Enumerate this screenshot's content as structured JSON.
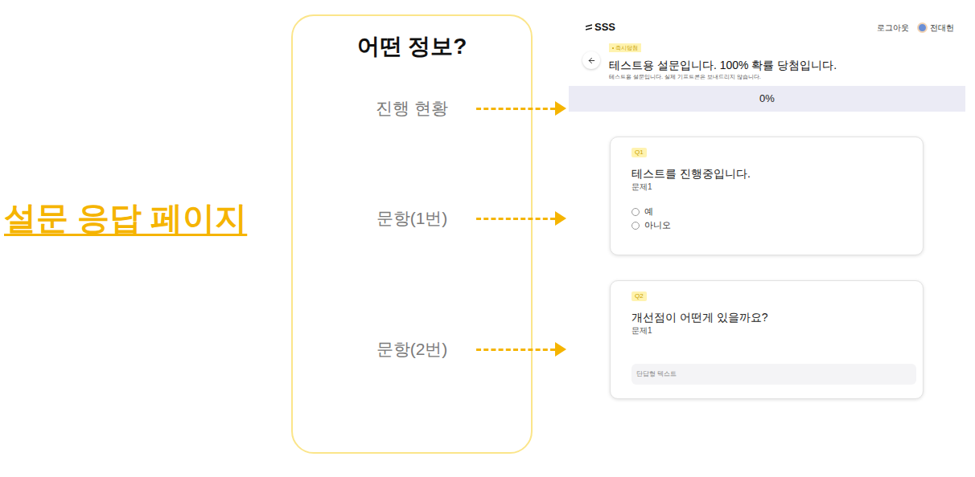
{
  "slide": {
    "title": "설문 응답 페이지"
  },
  "panel": {
    "heading": "어떤 정보?",
    "labels": [
      "진행 현황",
      "문항(1번)",
      "문항(2번)"
    ]
  },
  "screen": {
    "logo": "SSS",
    "logout": "로그아웃",
    "user": "전대헌",
    "badge": "즉시당첨",
    "title": "테스트용 설문입니다. 100% 확률 당첨입니다.",
    "description": "테스트용 설문입니다. 실제 기프트콘은 보내드리지 않습니다.",
    "progress": {
      "label": "0%",
      "level": 0
    },
    "questions": [
      {
        "number": "Q1",
        "title": "테스트를 진행중입니다.",
        "subtitle": "문제1",
        "kind": "choice",
        "options": [
          {
            "label": "예",
            "selected": false
          },
          {
            "label": "아니오",
            "selected": false
          }
        ]
      },
      {
        "number": "Q2",
        "title": "개선점이 어떤게 있을까요?",
        "subtitle": "문제1",
        "kind": "text",
        "placeholder": "단답형 텍스트"
      }
    ]
  }
}
